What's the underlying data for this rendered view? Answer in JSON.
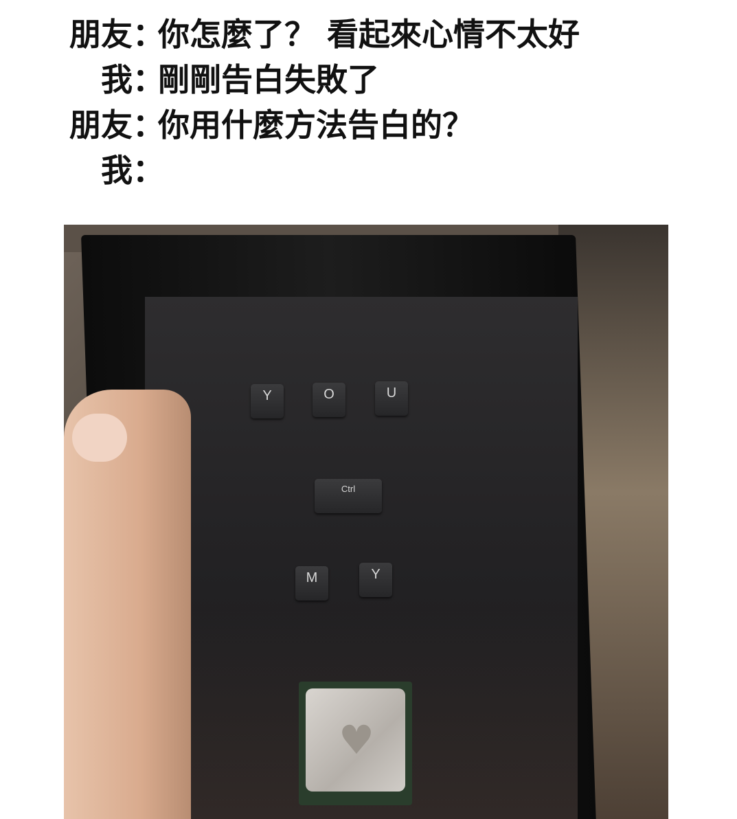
{
  "conversation": [
    {
      "speaker": "朋友",
      "colon": "：",
      "text": "你怎麼了？ 看起來心情不太好"
    },
    {
      "speaker": "我",
      "colon": "：",
      "text": "剛剛告白失敗了"
    },
    {
      "speaker": "朋友",
      "colon": "：",
      "text": "你用什麼方法告白的？"
    },
    {
      "speaker": "我",
      "colon": "：",
      "text": ""
    }
  ],
  "photo": {
    "keys": [
      "Y",
      "O",
      "U",
      "Ctrl",
      "M",
      "Y"
    ],
    "cpu_decoration": "heart"
  }
}
